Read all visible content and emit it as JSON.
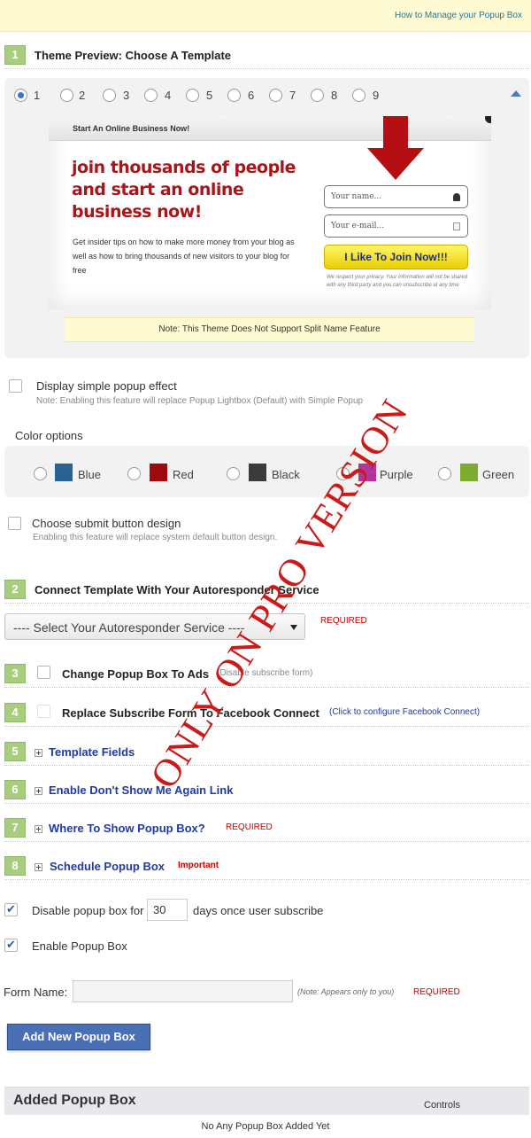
{
  "header": {
    "help_link": "How to Manage your Popup Box"
  },
  "step1": {
    "number": "1",
    "title": "Theme Preview: Choose A Template",
    "templates": [
      "1",
      "2",
      "3",
      "4",
      "5",
      "6",
      "7",
      "8",
      "9"
    ],
    "selected_template": "1"
  },
  "preview": {
    "topbar": "Start An Online Business Now!",
    "headline": "join thousands of people and start an online business now!",
    "body": "Get insider tips on how to make more money from your blog as well as how to bring thousands of new visitors to your blog for free",
    "name_placeholder": "Your name...",
    "email_placeholder": "Your e-mail...",
    "button": "I Like To Join Now!!!",
    "privacy": "We respect your privacy. Your information will not be shared with any third party and you can unsubscribe at any time",
    "note": "Note: This Theme Does Not Support Split Name Feature"
  },
  "simple_popup": {
    "label": "Display simple popup effect",
    "note": "Note: Enabling this feature will replace Popup Lightbox (Default) with Simple Popup"
  },
  "color_options": {
    "title": "Color options",
    "items": [
      {
        "label": "Blue",
        "color": "#2c6193"
      },
      {
        "label": "Red",
        "color": "#9d0b0e"
      },
      {
        "label": "Black",
        "color": "#3b3b3b"
      },
      {
        "label": "Purple",
        "color": "#b1369c"
      },
      {
        "label": "Green",
        "color": "#7dab2f"
      }
    ]
  },
  "submit_design": {
    "label": "Choose submit button design",
    "note": "Enabling this feature will replace system default button design."
  },
  "step2": {
    "number": "2",
    "title": "Connect Template With Your Autoresponder Service",
    "select_value": "---- Select Your Autoresponder Service ----",
    "required": "REQUIRED"
  },
  "step3": {
    "number": "3",
    "title": "Change Popup Box To Ads",
    "note": "(Disable subscribe form)"
  },
  "step4": {
    "number": "4",
    "title": "Replace Subscribe Form To Facebook Connect",
    "link": "(Click to configure Facebook Connect)"
  },
  "step5": {
    "number": "5",
    "title": "Template Fields"
  },
  "step6": {
    "number": "6",
    "title": "Enable Don't Show Me Again Link"
  },
  "step7": {
    "number": "7",
    "title": "Where To Show Popup Box?",
    "required": "REQUIRED"
  },
  "step8": {
    "number": "8",
    "title": "Schedule Popup Box",
    "important": "Important"
  },
  "disable_days": {
    "label_before": "Disable popup box for",
    "value": "30",
    "label_after": "days once user subscribe"
  },
  "enable_popup": {
    "label": "Enable Popup Box"
  },
  "form_name": {
    "label": "Form Name:",
    "value": "",
    "note": "(Note: Appears only to you)",
    "required": "REQUIRED"
  },
  "add_button": "Add New Popup Box",
  "added_table": {
    "title": "Added Popup Box",
    "controls": "Controls",
    "empty": "No Any Popup Box Added Yet"
  },
  "watermark": "ONLY ON PRO VERSION"
}
